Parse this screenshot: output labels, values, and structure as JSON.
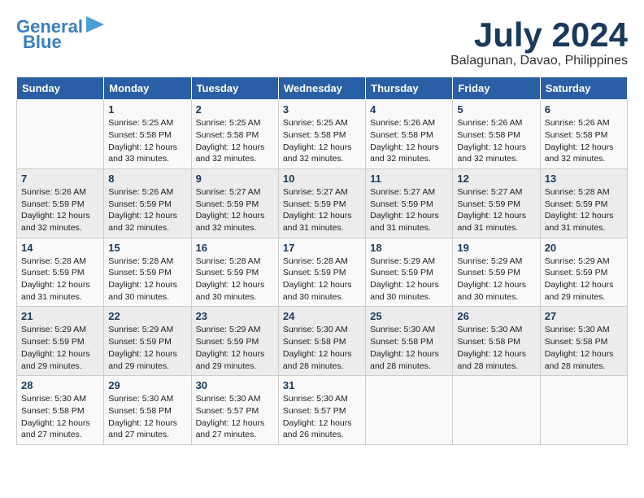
{
  "header": {
    "logo_line1": "General",
    "logo_line2": "Blue",
    "month_title": "July 2024",
    "location": "Balagunan, Davao, Philippines"
  },
  "days_of_week": [
    "Sunday",
    "Monday",
    "Tuesday",
    "Wednesday",
    "Thursday",
    "Friday",
    "Saturday"
  ],
  "weeks": [
    [
      {
        "day": "",
        "info": ""
      },
      {
        "day": "1",
        "info": "Sunrise: 5:25 AM\nSunset: 5:58 PM\nDaylight: 12 hours\nand 33 minutes."
      },
      {
        "day": "2",
        "info": "Sunrise: 5:25 AM\nSunset: 5:58 PM\nDaylight: 12 hours\nand 32 minutes."
      },
      {
        "day": "3",
        "info": "Sunrise: 5:25 AM\nSunset: 5:58 PM\nDaylight: 12 hours\nand 32 minutes."
      },
      {
        "day": "4",
        "info": "Sunrise: 5:26 AM\nSunset: 5:58 PM\nDaylight: 12 hours\nand 32 minutes."
      },
      {
        "day": "5",
        "info": "Sunrise: 5:26 AM\nSunset: 5:58 PM\nDaylight: 12 hours\nand 32 minutes."
      },
      {
        "day": "6",
        "info": "Sunrise: 5:26 AM\nSunset: 5:58 PM\nDaylight: 12 hours\nand 32 minutes."
      }
    ],
    [
      {
        "day": "7",
        "info": "Sunrise: 5:26 AM\nSunset: 5:59 PM\nDaylight: 12 hours\nand 32 minutes."
      },
      {
        "day": "8",
        "info": "Sunrise: 5:26 AM\nSunset: 5:59 PM\nDaylight: 12 hours\nand 32 minutes."
      },
      {
        "day": "9",
        "info": "Sunrise: 5:27 AM\nSunset: 5:59 PM\nDaylight: 12 hours\nand 32 minutes."
      },
      {
        "day": "10",
        "info": "Sunrise: 5:27 AM\nSunset: 5:59 PM\nDaylight: 12 hours\nand 31 minutes."
      },
      {
        "day": "11",
        "info": "Sunrise: 5:27 AM\nSunset: 5:59 PM\nDaylight: 12 hours\nand 31 minutes."
      },
      {
        "day": "12",
        "info": "Sunrise: 5:27 AM\nSunset: 5:59 PM\nDaylight: 12 hours\nand 31 minutes."
      },
      {
        "day": "13",
        "info": "Sunrise: 5:28 AM\nSunset: 5:59 PM\nDaylight: 12 hours\nand 31 minutes."
      }
    ],
    [
      {
        "day": "14",
        "info": "Sunrise: 5:28 AM\nSunset: 5:59 PM\nDaylight: 12 hours\nand 31 minutes."
      },
      {
        "day": "15",
        "info": "Sunrise: 5:28 AM\nSunset: 5:59 PM\nDaylight: 12 hours\nand 30 minutes."
      },
      {
        "day": "16",
        "info": "Sunrise: 5:28 AM\nSunset: 5:59 PM\nDaylight: 12 hours\nand 30 minutes."
      },
      {
        "day": "17",
        "info": "Sunrise: 5:28 AM\nSunset: 5:59 PM\nDaylight: 12 hours\nand 30 minutes."
      },
      {
        "day": "18",
        "info": "Sunrise: 5:29 AM\nSunset: 5:59 PM\nDaylight: 12 hours\nand 30 minutes."
      },
      {
        "day": "19",
        "info": "Sunrise: 5:29 AM\nSunset: 5:59 PM\nDaylight: 12 hours\nand 30 minutes."
      },
      {
        "day": "20",
        "info": "Sunrise: 5:29 AM\nSunset: 5:59 PM\nDaylight: 12 hours\nand 29 minutes."
      }
    ],
    [
      {
        "day": "21",
        "info": "Sunrise: 5:29 AM\nSunset: 5:59 PM\nDaylight: 12 hours\nand 29 minutes."
      },
      {
        "day": "22",
        "info": "Sunrise: 5:29 AM\nSunset: 5:59 PM\nDaylight: 12 hours\nand 29 minutes."
      },
      {
        "day": "23",
        "info": "Sunrise: 5:29 AM\nSunset: 5:59 PM\nDaylight: 12 hours\nand 29 minutes."
      },
      {
        "day": "24",
        "info": "Sunrise: 5:30 AM\nSunset: 5:58 PM\nDaylight: 12 hours\nand 28 minutes."
      },
      {
        "day": "25",
        "info": "Sunrise: 5:30 AM\nSunset: 5:58 PM\nDaylight: 12 hours\nand 28 minutes."
      },
      {
        "day": "26",
        "info": "Sunrise: 5:30 AM\nSunset: 5:58 PM\nDaylight: 12 hours\nand 28 minutes."
      },
      {
        "day": "27",
        "info": "Sunrise: 5:30 AM\nSunset: 5:58 PM\nDaylight: 12 hours\nand 28 minutes."
      }
    ],
    [
      {
        "day": "28",
        "info": "Sunrise: 5:30 AM\nSunset: 5:58 PM\nDaylight: 12 hours\nand 27 minutes."
      },
      {
        "day": "29",
        "info": "Sunrise: 5:30 AM\nSunset: 5:58 PM\nDaylight: 12 hours\nand 27 minutes."
      },
      {
        "day": "30",
        "info": "Sunrise: 5:30 AM\nSunset: 5:57 PM\nDaylight: 12 hours\nand 27 minutes."
      },
      {
        "day": "31",
        "info": "Sunrise: 5:30 AM\nSunset: 5:57 PM\nDaylight: 12 hours\nand 26 minutes."
      },
      {
        "day": "",
        "info": ""
      },
      {
        "day": "",
        "info": ""
      },
      {
        "day": "",
        "info": ""
      }
    ]
  ]
}
